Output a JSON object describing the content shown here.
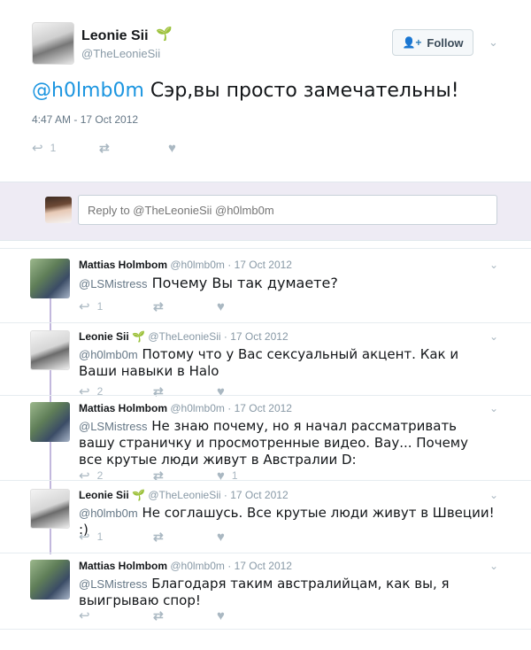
{
  "main_tweet": {
    "author_name": "Leonie Sii",
    "author_handle": "@TheLeonieSii",
    "follow_label": "Follow",
    "mention": "@h0lmb0m",
    "text": "Сэр,вы просто замечательны!",
    "timestamp": "4:47 AM - 17 Oct 2012",
    "reply_count": "1"
  },
  "reply_box": {
    "placeholder": "Reply to @TheLeonieSii @h0lmb0m"
  },
  "replies": [
    {
      "name": "Mattias Holmbom",
      "handle": "@h0lmb0m",
      "date": "· 17 Oct 2012",
      "mention": "@LSMistress",
      "text": "Почему Вы так думаете?",
      "reply_count": "1",
      "like_count": ""
    },
    {
      "name": "Leonie Sii",
      "handle": "@TheLeonieSii",
      "date": "· 17 Oct 2012",
      "mention": "@h0lmb0m",
      "text": "Потому что у Вас сексуальный акцент. Как и  Ваши навыки в Halo",
      "reply_count": "2",
      "like_count": ""
    },
    {
      "name": "Mattias Holmbom",
      "handle": "@h0lmb0m",
      "date": "· 17 Oct 2012",
      "mention": "@LSMistress",
      "text": "Не знаю почему,  но я начал рассматривать вашу страничку и просмотренные видео. Вау... Почему все крутые люди живут в Австралии D:",
      "reply_count": "2",
      "like_count": "1"
    },
    {
      "name": "Leonie Sii",
      "handle": "@TheLeonieSii",
      "date": "· 17 Oct 2012",
      "mention": "@h0lmb0m",
      "text": "Не соглашусь. Все крутые люди живут в Швеции! :)",
      "reply_count": "1",
      "like_count": ""
    },
    {
      "name": "Mattias Holmbom",
      "handle": "@h0lmb0m",
      "date": "· 17 Oct 2012",
      "mention": "@LSMistress",
      "text": "Благодаря таким австралийцам, как вы, я выигрываю спор!",
      "reply_count": "",
      "like_count": ""
    }
  ],
  "colors": {
    "accent_blue": "#1b95e0",
    "reply_bar_bg": "#eeebf4",
    "thread_line": "#c2b8dd",
    "sprout_green": "#3a9d2e"
  },
  "icons": [
    "reply-icon",
    "retweet-icon",
    "like-icon",
    "sprout-icon",
    "follow-person-icon",
    "chevron-down-icon"
  ]
}
